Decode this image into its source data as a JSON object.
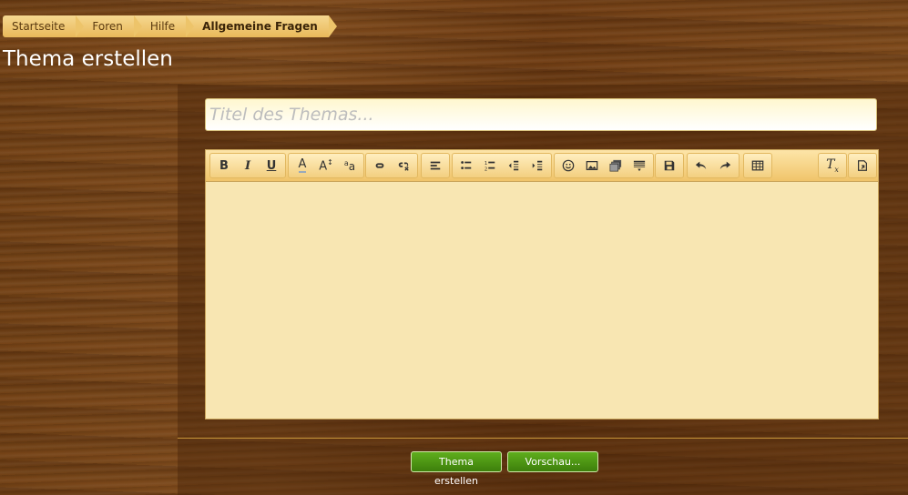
{
  "breadcrumb": {
    "items": [
      "Startseite",
      "Foren",
      "Hilfe",
      "Allgemeine Fragen"
    ]
  },
  "page": {
    "title": "Thema erstellen"
  },
  "form": {
    "title_placeholder": "Titel des Themas...",
    "title_value": ""
  },
  "toolbar": {
    "buttons": [
      "bold-icon",
      "italic-icon",
      "underline-icon",
      "text-color-icon",
      "font-size-icon",
      "font-family-icon",
      "link-icon",
      "unlink-icon",
      "align-icon",
      "bullet-list-icon",
      "numbered-list-icon",
      "outdent-icon",
      "indent-icon",
      "smiley-icon",
      "image-icon",
      "media-icon",
      "quote-icon",
      "save-draft-icon",
      "undo-icon",
      "redo-icon",
      "table-icon",
      "remove-format-icon",
      "toggle-bbcode-icon"
    ]
  },
  "buttons": {
    "create_label": "Thema erstellen",
    "preview_label": "Vorschau..."
  },
  "colors": {
    "accent": "#f0c46a",
    "action_green": "#4a9214",
    "editor_bg": "#f8e6b2"
  }
}
